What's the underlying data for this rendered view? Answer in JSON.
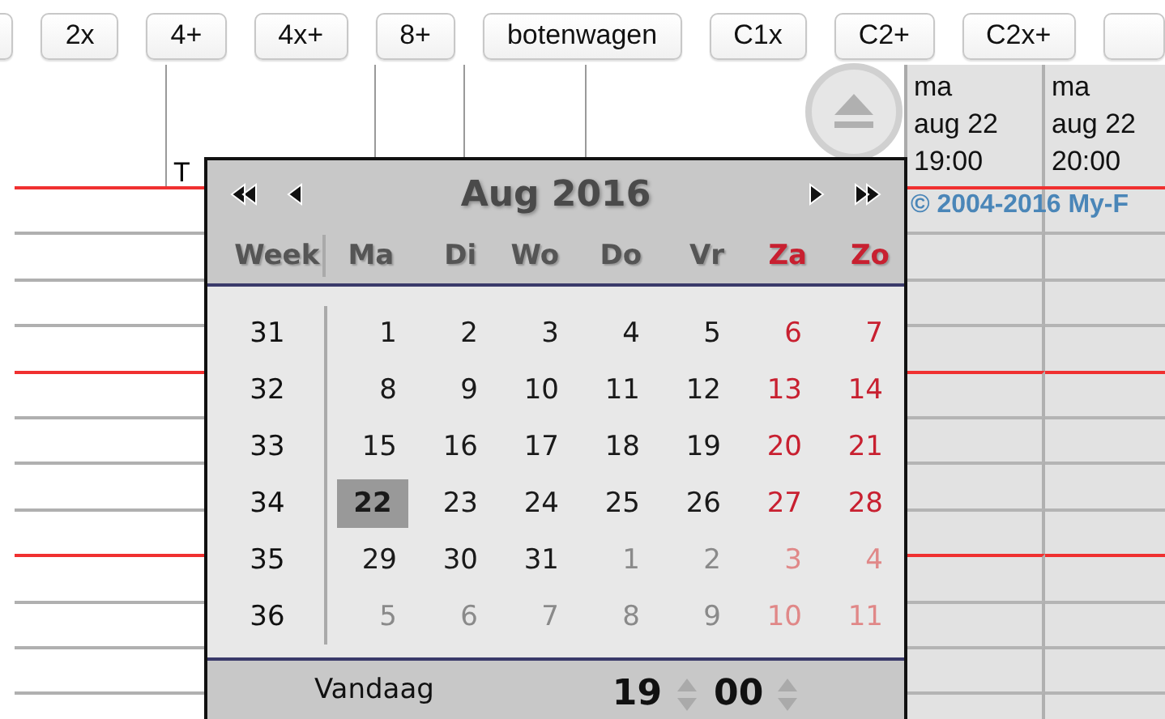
{
  "toolbar": {
    "buttons": [
      {
        "label": "2x"
      },
      {
        "label": "4+"
      },
      {
        "label": "4x+"
      },
      {
        "label": "8+"
      },
      {
        "label": "botenwagen"
      },
      {
        "label": "C1x"
      },
      {
        "label": "C2+"
      },
      {
        "label": "C2x+"
      }
    ]
  },
  "grid": {
    "column_header": "T",
    "slots": [
      {
        "day": "ma",
        "date": "aug 22",
        "time": "19:00"
      },
      {
        "day": "ma",
        "date": "aug 22",
        "time": "20:00"
      }
    ],
    "copyright": "© 2004-2016 My-F"
  },
  "calendar": {
    "title": "Aug 2016",
    "week_label": "Week",
    "weekdays": [
      {
        "label": "Ma",
        "weekend": false
      },
      {
        "label": "Di",
        "weekend": false
      },
      {
        "label": "Wo",
        "weekend": false
      },
      {
        "label": "Do",
        "weekend": false
      },
      {
        "label": "Vr",
        "weekend": false
      },
      {
        "label": "Za",
        "weekend": true
      },
      {
        "label": "Zo",
        "weekend": true
      }
    ],
    "weeks": [
      {
        "week": "31",
        "days": [
          {
            "day": "1",
            "weekend": false,
            "other_month": false,
            "selected": false
          },
          {
            "day": "2",
            "weekend": false,
            "other_month": false,
            "selected": false
          },
          {
            "day": "3",
            "weekend": false,
            "other_month": false,
            "selected": false
          },
          {
            "day": "4",
            "weekend": false,
            "other_month": false,
            "selected": false
          },
          {
            "day": "5",
            "weekend": false,
            "other_month": false,
            "selected": false
          },
          {
            "day": "6",
            "weekend": true,
            "other_month": false,
            "selected": false
          },
          {
            "day": "7",
            "weekend": true,
            "other_month": false,
            "selected": false
          }
        ]
      },
      {
        "week": "32",
        "days": [
          {
            "day": "8",
            "weekend": false,
            "other_month": false,
            "selected": false
          },
          {
            "day": "9",
            "weekend": false,
            "other_month": false,
            "selected": false
          },
          {
            "day": "10",
            "weekend": false,
            "other_month": false,
            "selected": false
          },
          {
            "day": "11",
            "weekend": false,
            "other_month": false,
            "selected": false
          },
          {
            "day": "12",
            "weekend": false,
            "other_month": false,
            "selected": false
          },
          {
            "day": "13",
            "weekend": true,
            "other_month": false,
            "selected": false
          },
          {
            "day": "14",
            "weekend": true,
            "other_month": false,
            "selected": false
          }
        ]
      },
      {
        "week": "33",
        "days": [
          {
            "day": "15",
            "weekend": false,
            "other_month": false,
            "selected": false
          },
          {
            "day": "16",
            "weekend": false,
            "other_month": false,
            "selected": false
          },
          {
            "day": "17",
            "weekend": false,
            "other_month": false,
            "selected": false
          },
          {
            "day": "18",
            "weekend": false,
            "other_month": false,
            "selected": false
          },
          {
            "day": "19",
            "weekend": false,
            "other_month": false,
            "selected": false
          },
          {
            "day": "20",
            "weekend": true,
            "other_month": false,
            "selected": false
          },
          {
            "day": "21",
            "weekend": true,
            "other_month": false,
            "selected": false
          }
        ]
      },
      {
        "week": "34",
        "days": [
          {
            "day": "22",
            "weekend": false,
            "other_month": false,
            "selected": true
          },
          {
            "day": "23",
            "weekend": false,
            "other_month": false,
            "selected": false
          },
          {
            "day": "24",
            "weekend": false,
            "other_month": false,
            "selected": false
          },
          {
            "day": "25",
            "weekend": false,
            "other_month": false,
            "selected": false
          },
          {
            "day": "26",
            "weekend": false,
            "other_month": false,
            "selected": false
          },
          {
            "day": "27",
            "weekend": true,
            "other_month": false,
            "selected": false
          },
          {
            "day": "28",
            "weekend": true,
            "other_month": false,
            "selected": false
          }
        ]
      },
      {
        "week": "35",
        "days": [
          {
            "day": "29",
            "weekend": false,
            "other_month": false,
            "selected": false
          },
          {
            "day": "30",
            "weekend": false,
            "other_month": false,
            "selected": false
          },
          {
            "day": "31",
            "weekend": false,
            "other_month": false,
            "selected": false
          },
          {
            "day": "1",
            "weekend": false,
            "other_month": true,
            "selected": false
          },
          {
            "day": "2",
            "weekend": false,
            "other_month": true,
            "selected": false
          },
          {
            "day": "3",
            "weekend": true,
            "other_month": true,
            "selected": false
          },
          {
            "day": "4",
            "weekend": true,
            "other_month": true,
            "selected": false
          }
        ]
      },
      {
        "week": "36",
        "days": [
          {
            "day": "5",
            "weekend": false,
            "other_month": true,
            "selected": false
          },
          {
            "day": "6",
            "weekend": false,
            "other_month": true,
            "selected": false
          },
          {
            "day": "7",
            "weekend": false,
            "other_month": true,
            "selected": false
          },
          {
            "day": "8",
            "weekend": false,
            "other_month": true,
            "selected": false
          },
          {
            "day": "9",
            "weekend": false,
            "other_month": true,
            "selected": false
          },
          {
            "day": "10",
            "weekend": true,
            "other_month": true,
            "selected": false
          },
          {
            "day": "11",
            "weekend": true,
            "other_month": true,
            "selected": false
          }
        ]
      }
    ],
    "footer": {
      "today": "Vandaag",
      "hour": "19",
      "minute": "00"
    }
  }
}
